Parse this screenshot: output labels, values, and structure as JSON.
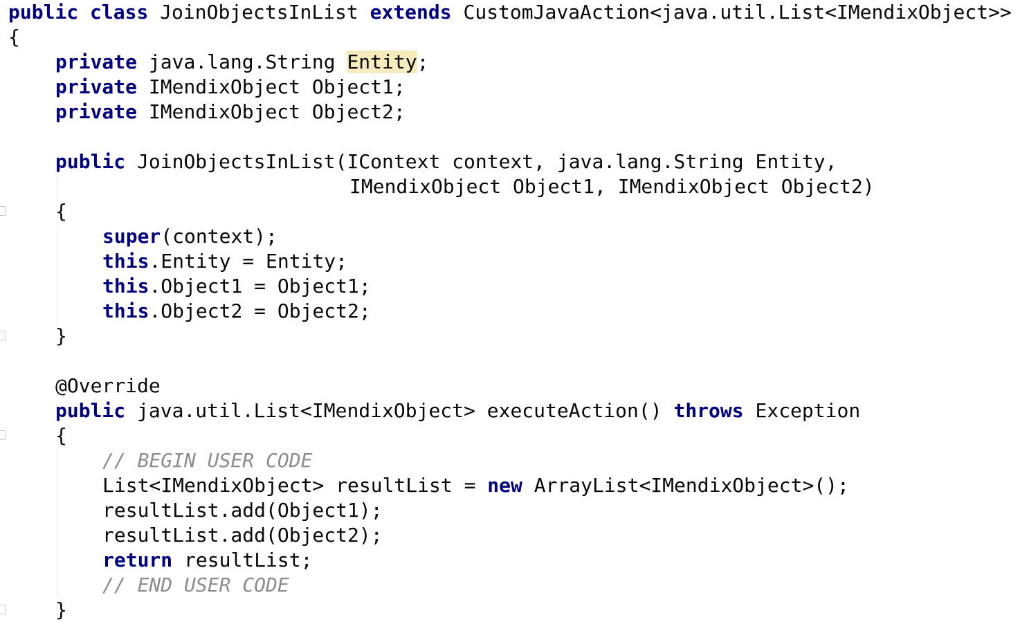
{
  "code": {
    "lines": {
      "l1": {
        "kw1": "public",
        "kw2": "class",
        "rest": " JoinObjectsInList ",
        "kw3": "extends",
        "tail": " CustomJavaAction<java.util.List<IMendixObject>>"
      },
      "l2": {
        "text": "{"
      },
      "l3": {
        "kw": "private",
        "pre": " java.lang.String ",
        "hl": "Entity",
        "post": ";"
      },
      "l4": {
        "kw": "private",
        "rest": " IMendixObject Object1;"
      },
      "l5": {
        "kw": "private",
        "rest": " IMendixObject Object2;"
      },
      "l7": {
        "kw": "public",
        "rest": " JoinObjectsInList(IContext context, java.lang.String Entity,"
      },
      "l8": {
        "text": "IMendixObject Object1, IMendixObject Object2)"
      },
      "l9": {
        "text": "{"
      },
      "l10": {
        "kw": "super",
        "rest": "(context);"
      },
      "l11": {
        "kw": "this",
        "rest": ".Entity = Entity;"
      },
      "l12": {
        "kw": "this",
        "rest": ".Object1 = Object1;"
      },
      "l13": {
        "kw": "this",
        "rest": ".Object2 = Object2;"
      },
      "l14": {
        "text": "}"
      },
      "l16": {
        "text": "@Override"
      },
      "l17": {
        "kw1": "public",
        "mid": " java.util.List<IMendixObject> executeAction() ",
        "kw2": "throws",
        "rest": " Exception"
      },
      "l18": {
        "text": "{"
      },
      "l19": {
        "comment": "// BEGIN USER CODE"
      },
      "l20": {
        "pre": "List<IMendixObject> resultList = ",
        "kw": "new",
        "post": " ArrayList<IMendixObject>();"
      },
      "l21": {
        "text": "resultList.add(Object1);"
      },
      "l22": {
        "text": "resultList.add(Object2);"
      },
      "l23": {
        "kw": "return",
        "rest": " resultList;"
      },
      "l24": {
        "comment": "// END USER CODE"
      },
      "l25": {
        "text": "}"
      }
    }
  },
  "colors": {
    "background": "#ffffff",
    "text": "#080808",
    "keyword": "#000080",
    "comment": "#8c8c8c",
    "highlight": "#f6ebbc"
  }
}
